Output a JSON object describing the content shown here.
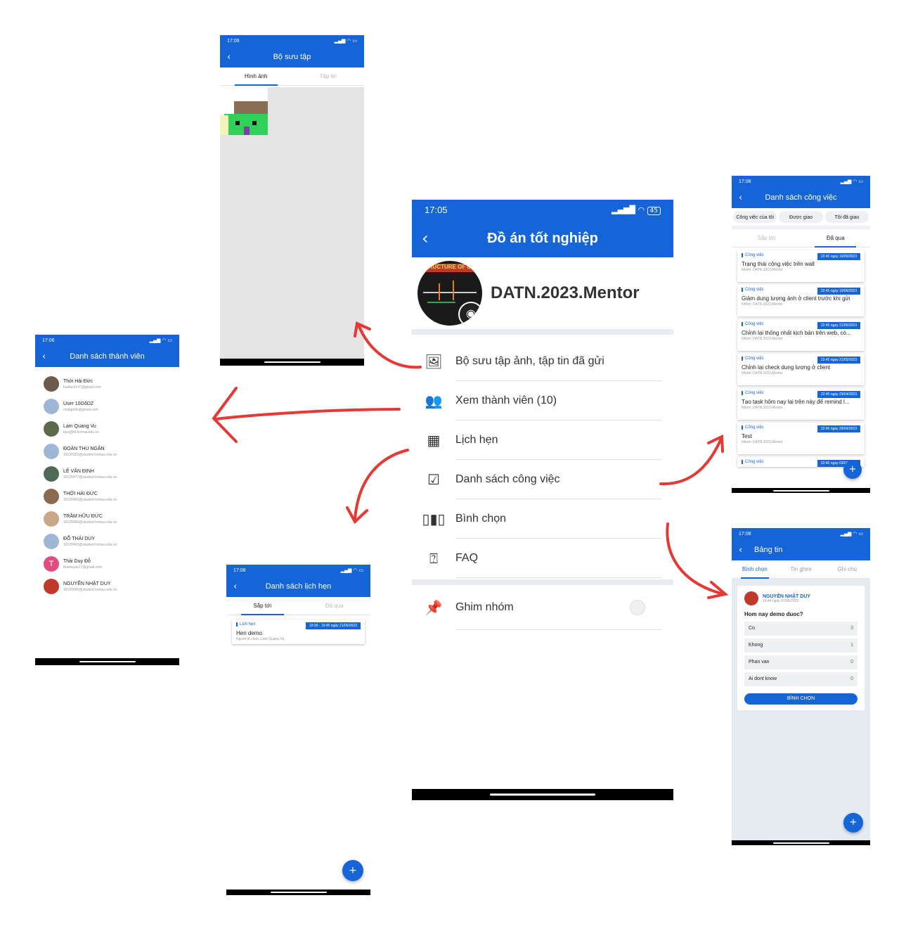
{
  "main": {
    "status_time": "17:05",
    "status_icons": "‚••••",
    "battery": "45",
    "title": "Đồ án tốt nghiệp",
    "group_name": "DATN.2023.Mentor",
    "avatar_caption": "RUCTURE OF U",
    "menu": [
      {
        "label": "Bộ sưu tập ảnh, tập tin đã gửi",
        "icon": "gallery-icon"
      },
      {
        "label": "Xem thành viên (10)",
        "icon": "members-icon"
      },
      {
        "label": "Lịch hẹn",
        "icon": "calendar-icon"
      },
      {
        "label": "Danh sách công việc",
        "icon": "tasklist-icon"
      },
      {
        "label": "Bình chọn",
        "icon": "poll-icon"
      },
      {
        "label": "FAQ",
        "icon": "faq-icon"
      }
    ],
    "pin_label": "Ghim nhóm"
  },
  "gallery": {
    "status_time": "17:06",
    "title": "Bộ sưu tập",
    "tabs": [
      "Hình ảnh",
      "Tập tin"
    ]
  },
  "members": {
    "status_time": "17:06",
    "title": "Danh sách thành viên",
    "list": [
      {
        "name": "Thới Hải Đức",
        "email": "haiduc0147@gmail.com"
      },
      {
        "name": "User 10G6DZ",
        "email": "chatgpt4s@gmail.com"
      },
      {
        "name": "Lam Quang Vu",
        "email": "lqvu@fit.hcmus.edu.vn"
      },
      {
        "name": "ĐOÀN THU NGÂN",
        "email": "19120302@student.hcmus.edu.vn"
      },
      {
        "name": "LÊ VĂN ĐỊNH",
        "email": "19120477@student.hcmus.edu.vn"
      },
      {
        "name": "THỚI HẢI ĐỨC",
        "email": "19120483@student.hcmus.edu.vn"
      },
      {
        "name": "TRẦM HỮU ĐỨC",
        "email": "19120484@student.hcmus.edu.vn"
      },
      {
        "name": "ĐỖ THÁI DUY",
        "email": "19120492@student.hcmus.edu.vn"
      },
      {
        "name": "Thái Duy Đỗ",
        "email": "thaiduydo17@gmail.com",
        "initial": "T"
      },
      {
        "name": "NGUYỄN NHẬT DUY",
        "email": "19120495@student.hcmus.edu.vn"
      }
    ]
  },
  "schedule": {
    "status_time": "17:08",
    "title": "Danh sách lịch hẹn",
    "tabs": [
      "Sắp tới",
      "Đã qua"
    ],
    "card": {
      "tag": "Lịch hẹn",
      "time": "19:00 - 19:45 ngày 21/06/2023",
      "title": "Hen demo",
      "sub": "Người tổ chức: Lam Quang Vu"
    },
    "fab": "+"
  },
  "tasks": {
    "status_time": "17:08",
    "title": "Danh sách công việc",
    "chips": [
      "Công việc của tôi",
      "Được giao",
      "Tôi đã giao"
    ],
    "tabs": [
      "Sắp tới",
      "Đã qua"
    ],
    "items": [
      {
        "tag": "Công việc",
        "time": "22:45 ngày 10/06/2023",
        "title": "Trạng thái công việc trên wall",
        "sub": "Nhóm: DATN.2023.Mentor"
      },
      {
        "tag": "Công việc",
        "time": "22:45 ngày 10/06/2023",
        "title": "Giảm dung lượng ảnh ở client trước khi gửi",
        "sub": "Nhóm: DATN.2023.Mentor"
      },
      {
        "tag": "Công việc",
        "time": "22:45 ngày 21/05/2023",
        "title": "Chỉnh lại thống nhất kịch bản trên web, có...",
        "sub": "Nhóm: DATN.2023.Mentor"
      },
      {
        "tag": "Công việc",
        "time": "22:45 ngày 21/05/2023",
        "title": "Chỉnh lại check dung lượng ở client",
        "sub": "Nhóm: DATN.2023.Mentor"
      },
      {
        "tag": "Công việc",
        "time": "22:45 ngày 29/04/2023",
        "title": "Tạo task hôm nay lại trên này để remind l...",
        "sub": "Nhóm: DATN.2023.Mentor"
      },
      {
        "tag": "Công việc",
        "time": "22:45 ngày 29/04/2023",
        "title": "Test",
        "sub": "Nhóm: DATN.2023.Mentor"
      },
      {
        "tag": "Công việc",
        "time": "22:45 ngày 03/04/2023",
        "title": "",
        "sub": ""
      }
    ],
    "fab": "+"
  },
  "board": {
    "status_time": "17:08",
    "title": "Bảng tin",
    "tabs": [
      "Bình chọn",
      "Tin ghim",
      "Ghi chú"
    ],
    "author": "NGUYỄN NHẬT DUY",
    "posted": "18:44 ngày 07/06/2023",
    "question": "Hom nay demo duoc?",
    "options": [
      {
        "label": "Co",
        "count": "3"
      },
      {
        "label": "Khong",
        "count": "1"
      },
      {
        "label": "Phan van",
        "count": "0"
      },
      {
        "label": "Ai dont know",
        "count": "0"
      }
    ],
    "vote_label": "BÌNH CHỌN",
    "fab": "+"
  },
  "colors": {
    "primary": "#1565d8",
    "arrow": "#e53935"
  }
}
